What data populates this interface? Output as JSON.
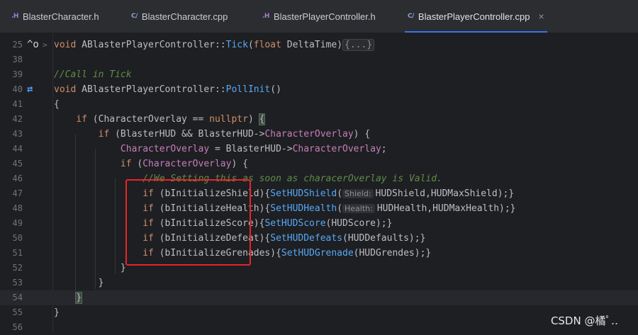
{
  "tabs": [
    {
      "type": ".H",
      "name": "BlasterCharacter.h",
      "active": false
    },
    {
      "type": "C/",
      "name": "BlasterCharacter.cpp",
      "active": false
    },
    {
      "type": ".H",
      "name": "BlasterPlayerController.h",
      "active": false
    },
    {
      "type": "C/",
      "name": "BlasterPlayerController.cpp",
      "active": true
    }
  ],
  "close_glyph": "×",
  "gutter_icons": {
    "line25": "^o",
    "line40": "⇄",
    "fold25": ">"
  },
  "lines": [
    {
      "n": "25"
    },
    {
      "n": "38"
    },
    {
      "n": "39"
    },
    {
      "n": "40"
    },
    {
      "n": "41"
    },
    {
      "n": "42"
    },
    {
      "n": "43"
    },
    {
      "n": "44"
    },
    {
      "n": "45"
    },
    {
      "n": "46"
    },
    {
      "n": "47"
    },
    {
      "n": "48"
    },
    {
      "n": "49"
    },
    {
      "n": "50"
    },
    {
      "n": "51"
    },
    {
      "n": "52"
    },
    {
      "n": "53"
    },
    {
      "n": "54"
    },
    {
      "n": "55"
    },
    {
      "n": "56"
    }
  ],
  "code": {
    "l25": {
      "kw": "void",
      "cls": "ABlasterPlayerController",
      "sep": "::",
      "fn": "Tick",
      "p1": "(",
      "ty": "float",
      "arg": " DeltaTime",
      "p2": ")",
      "fold": "{...}"
    },
    "l39": "//Call in Tick",
    "l40": {
      "kw": "void",
      "cls": "ABlasterPlayerController",
      "sep": "::",
      "fn": "PollInit",
      "rest": "()"
    },
    "l41": "{",
    "l42": {
      "kw": "if",
      "a": " (CharacterOverlay == ",
      "b": "nullptr",
      "c": ") ",
      "d": "{"
    },
    "l43": {
      "kw": "if",
      "a": " (BlasterHUD && BlasterHUD->",
      "b": "CharacterOverlay",
      "c": ") {"
    },
    "l44": {
      "a": "CharacterOverlay",
      "b": " = BlasterHUD->",
      "c": "CharacterOverlay",
      "d": ";"
    },
    "l45": {
      "kw": "if",
      "a": " (",
      "b": "CharacterOverlay",
      "c": ") {"
    },
    "l46": "//We Setting this as soon as characerOverlay is Valid.",
    "l47": {
      "kw": "if",
      "a": " (bInitializeShield){",
      "fn": "SetHUDShield",
      "p": "(",
      "hint": "Shield:",
      "b": "HUDShield,HUDMaxShield);}"
    },
    "l48": {
      "kw": "if",
      "a": " (bInitializeHealth){",
      "fn": "SetHUDHealth",
      "p": "(",
      "hint": "Health:",
      "b": "HUDHealth,HUDMaxHealth);}"
    },
    "l49": {
      "kw": "if",
      "a": " (bInitializeScore){",
      "fn": "SetHUDScore",
      "b": "(HUDScore);}"
    },
    "l50": {
      "kw": "if",
      "a": " (bInitializeDefeat){",
      "fn": "SetHUDDefeats",
      "b": "(HUDDefaults);}"
    },
    "l51": {
      "kw": "if",
      "a": " (bInitializeGrenades){",
      "fn": "SetHUDGrenade",
      "b": "(HUDGrendes);}"
    },
    "l52": "}",
    "l53": "}",
    "l54": "}",
    "l55": "}"
  },
  "watermark": "CSDN @橘",
  "watermark_tail": "ﾟ‥"
}
